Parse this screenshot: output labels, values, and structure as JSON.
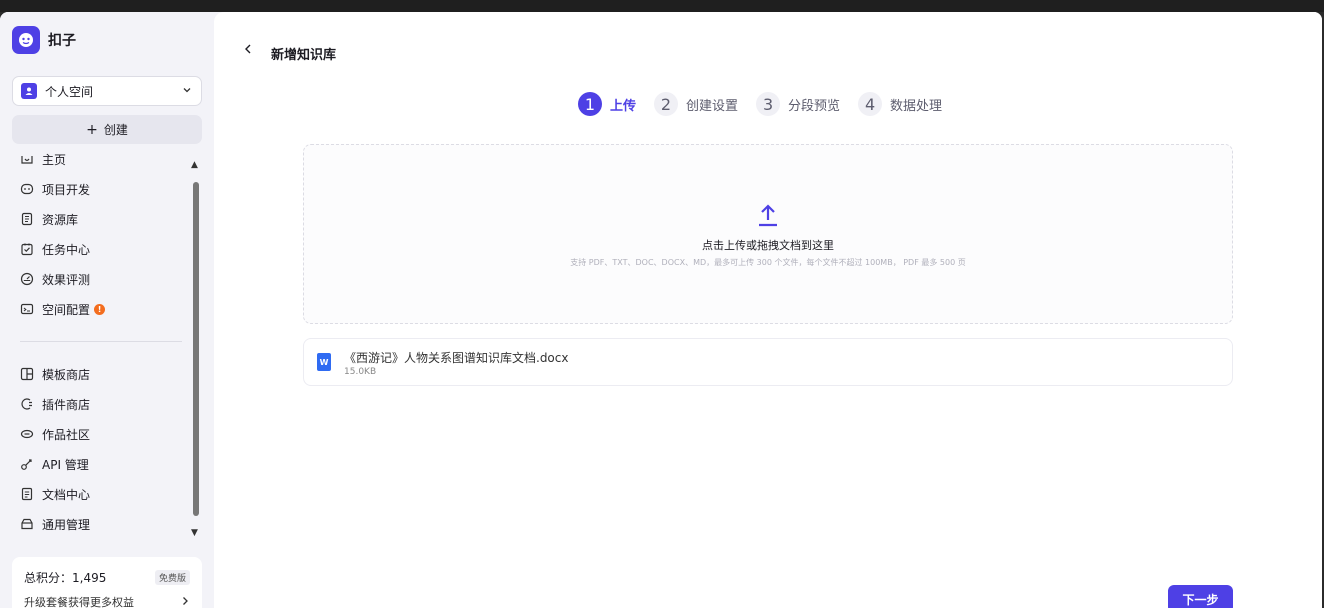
{
  "brand": {
    "name": "扣子"
  },
  "space": {
    "label": "个人空间"
  },
  "sidebar": {
    "create_label": "创建",
    "items": [
      {
        "label": "主页",
        "icon": "home-icon"
      },
      {
        "label": "项目开发",
        "icon": "robot-icon"
      },
      {
        "label": "资源库",
        "icon": "library-icon"
      },
      {
        "label": "任务中心",
        "icon": "task-icon"
      },
      {
        "label": "效果评测",
        "icon": "gauge-icon"
      },
      {
        "label": "空间配置",
        "icon": "config-icon",
        "badge": "!"
      }
    ],
    "items2": [
      {
        "label": "模板商店",
        "icon": "template-icon"
      },
      {
        "label": "插件商店",
        "icon": "plugin-icon"
      },
      {
        "label": "作品社区",
        "icon": "community-icon"
      },
      {
        "label": "API 管理",
        "icon": "api-icon"
      },
      {
        "label": "文档中心",
        "icon": "doc-icon"
      },
      {
        "label": "通用管理",
        "icon": "manage-icon"
      }
    ]
  },
  "credits": {
    "label": "总积分：1,495",
    "plan": "免费版",
    "upgrade": "升级套餐获得更多权益"
  },
  "page": {
    "title": "新增知识库"
  },
  "steps": [
    {
      "num": "1",
      "label": "上传",
      "active": true
    },
    {
      "num": "2",
      "label": "创建设置",
      "active": false
    },
    {
      "num": "3",
      "label": "分段预览",
      "active": false
    },
    {
      "num": "4",
      "label": "数据处理",
      "active": false
    }
  ],
  "dropzone": {
    "title": "点击上传或拖拽文档到这里",
    "hint": "支持 PDF、TXT、DOC、DOCX、MD，最多可上传 300 个文件，每个文件不超过 100MB， PDF 最多 500 页"
  },
  "file": {
    "type_badge": "W",
    "name": "《西游记》人物关系图谱知识库文档.docx",
    "size": "15.0KB"
  },
  "actions": {
    "next": "下一步"
  },
  "colors": {
    "accent": "#4e40e5",
    "alert": "#f36d1f",
    "word_blue": "#2f6bf2"
  }
}
